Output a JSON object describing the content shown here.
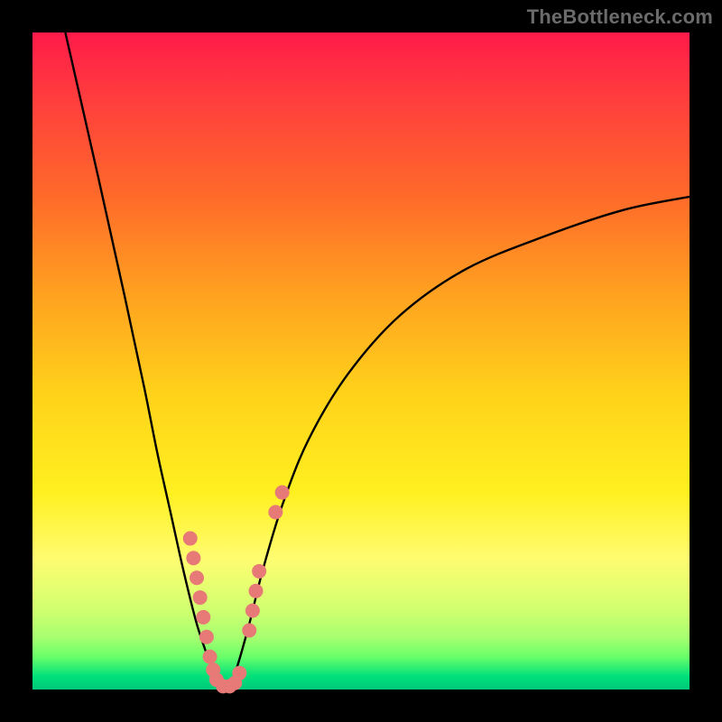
{
  "watermark": "TheBottleneck.com",
  "colors": {
    "curve": "#000000",
    "marker_fill": "#e77a77",
    "marker_stroke": "#c95f5c"
  },
  "chart_data": {
    "type": "line",
    "title": "",
    "xlabel": "",
    "ylabel": "",
    "xlim": [
      0,
      100
    ],
    "ylim": [
      0,
      100
    ],
    "grid": false,
    "legend": false,
    "series": [
      {
        "name": "bottleneck-curve",
        "x": [
          5,
          10,
          14,
          17,
          19,
          21,
          23,
          25,
          27,
          28,
          29,
          30,
          31,
          33,
          35,
          38,
          42,
          48,
          56,
          66,
          78,
          90,
          100
        ],
        "y": [
          100,
          78,
          60,
          46,
          36,
          27,
          18,
          10,
          4,
          1,
          0,
          1,
          3,
          10,
          18,
          28,
          38,
          48,
          57,
          64,
          69,
          73,
          75
        ]
      }
    ],
    "markers": [
      {
        "x": 24,
        "y": 23
      },
      {
        "x": 24.5,
        "y": 20
      },
      {
        "x": 25,
        "y": 17
      },
      {
        "x": 25.5,
        "y": 14
      },
      {
        "x": 26,
        "y": 11
      },
      {
        "x": 26.5,
        "y": 8
      },
      {
        "x": 27,
        "y": 5
      },
      {
        "x": 27.5,
        "y": 3
      },
      {
        "x": 28,
        "y": 1.5
      },
      {
        "x": 29,
        "y": 0.5
      },
      {
        "x": 30,
        "y": 0.5
      },
      {
        "x": 30.8,
        "y": 1
      },
      {
        "x": 31.5,
        "y": 2.5
      },
      {
        "x": 33,
        "y": 9
      },
      {
        "x": 33.5,
        "y": 12
      },
      {
        "x": 34,
        "y": 15
      },
      {
        "x": 34.5,
        "y": 18
      },
      {
        "x": 37,
        "y": 27
      },
      {
        "x": 38,
        "y": 30
      }
    ],
    "marker_radius_px": 8
  }
}
